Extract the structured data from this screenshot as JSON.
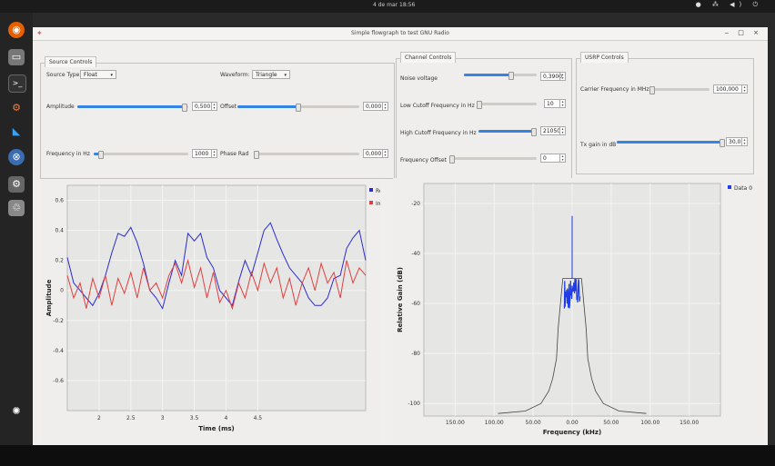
{
  "system": {
    "clock": "4 de mar  18:56",
    "tray": "● ⁂ ◀) ⏻"
  },
  "window": {
    "title": "Simple flowgraph to test GNU Radio",
    "controls": "‒ □ ×"
  },
  "source_controls": {
    "tab": "Source Controls",
    "source_type_label": "Source Type:",
    "source_type_value": "Float",
    "waveform_label": "Waveform:",
    "waveform_value": "Triangle",
    "amplitude_label": "Amplitude",
    "amplitude_value": "0,500",
    "amplitude_level": 0.97,
    "offset_label": "Offset",
    "offset_value": "0,000",
    "offset_level": 0.5,
    "frequency_label": "Frequency in Hz",
    "frequency_value": "1000",
    "frequency_level": 0.08,
    "phase_label": "Phase Rad",
    "phase_value": "0,000",
    "phase_level": 0.0
  },
  "channel_controls": {
    "tab": "Channel Controls",
    "noise_label": "Noise voltage",
    "noise_value": "0,3900",
    "noise_level": 0.65,
    "lowcut_label": "Low Cutoff Frequency in Hz",
    "lowcut_value": "10",
    "lowcut_level": 0.0,
    "highcut_label": "High Cutoff Frequency in Hz",
    "highcut_value": "21050",
    "highcut_level": 0.96,
    "freqoff_label": "Frequency Offset",
    "freqoff_value": "0",
    "freqoff_level": 0.0
  },
  "usrp_controls": {
    "tab": "USRP Controls",
    "carrier_label": "Carrier Frequency in MHz",
    "carrier_value": "100,000",
    "carrier_level": 0.02,
    "txgain_label": "Tx gain in dB",
    "txgain_value": "30,0",
    "txgain_level": 0.98
  },
  "colors": {
    "accent": "#3584e4",
    "real": "#2b2bd0",
    "imag": "#e04040",
    "spectrum": "#1e3ce8"
  },
  "chart_data": [
    {
      "type": "line",
      "xlabel": "Time (ms)",
      "ylabel": "Amplitude",
      "xlim": [
        1.5,
        6.2
      ],
      "ylim": [
        -0.8,
        0.7
      ],
      "xticks": [
        "2",
        "2.5",
        "3",
        "3.5",
        "4",
        "4.5"
      ],
      "xtick_values": [
        2,
        2.5,
        3,
        3.5,
        4,
        4.5
      ],
      "yticks": [
        "0.6",
        "0.4",
        "0.2",
        "0",
        "-0.2",
        "-0.4",
        "-0.6"
      ],
      "ytick_values": [
        0.6,
        0.4,
        0.2,
        0,
        -0.2,
        -0.4,
        -0.6
      ],
      "legend": "top-right",
      "series": [
        {
          "name": "Real",
          "x": [
            1.5,
            1.6,
            1.7,
            1.8,
            1.9,
            2.0,
            2.1,
            2.2,
            2.3,
            2.4,
            2.5,
            2.6,
            2.7,
            2.8,
            2.9,
            3.0,
            3.1,
            3.2,
            3.3,
            3.4,
            3.5,
            3.6,
            3.7,
            3.8,
            3.9,
            4.0,
            4.1,
            4.2,
            4.3,
            4.4,
            4.5,
            4.6,
            4.7,
            4.8,
            4.9,
            5.0,
            5.1,
            5.2,
            5.3,
            5.4,
            5.5,
            5.6,
            5.7,
            5.8,
            5.9,
            6.0,
            6.1,
            6.2
          ],
          "values": [
            0.22,
            0.05,
            0.0,
            -0.05,
            -0.1,
            -0.02,
            0.1,
            0.25,
            0.38,
            0.36,
            0.42,
            0.32,
            0.18,
            0.0,
            -0.05,
            -0.12,
            0.05,
            0.2,
            0.1,
            0.38,
            0.33,
            0.38,
            0.22,
            0.15,
            0.0,
            -0.05,
            -0.1,
            0.06,
            0.2,
            0.1,
            0.25,
            0.4,
            0.45,
            0.34,
            0.24,
            0.15,
            0.1,
            0.05,
            -0.05,
            -0.1,
            -0.1,
            -0.05,
            0.08,
            0.1,
            0.28,
            0.35,
            0.4,
            0.2
          ]
        },
        {
          "name": "Imag",
          "x": [
            1.5,
            1.6,
            1.7,
            1.8,
            1.9,
            2.0,
            2.1,
            2.2,
            2.3,
            2.4,
            2.5,
            2.6,
            2.7,
            2.8,
            2.9,
            3.0,
            3.1,
            3.2,
            3.3,
            3.4,
            3.5,
            3.6,
            3.7,
            3.8,
            3.9,
            4.0,
            4.1,
            4.2,
            4.3,
            4.4,
            4.5,
            4.6,
            4.7,
            4.8,
            4.9,
            5.0,
            5.1,
            5.2,
            5.3,
            5.4,
            5.5,
            5.6,
            5.7,
            5.8,
            5.9,
            6.0,
            6.1,
            6.2
          ],
          "values": [
            0.1,
            -0.05,
            0.05,
            -0.12,
            0.08,
            -0.05,
            0.1,
            -0.1,
            0.08,
            -0.02,
            0.12,
            -0.05,
            0.15,
            0.0,
            0.05,
            -0.05,
            0.1,
            0.18,
            0.05,
            0.2,
            0.02,
            0.15,
            -0.05,
            0.12,
            -0.08,
            0.0,
            -0.12,
            0.05,
            -0.05,
            0.12,
            0.0,
            0.18,
            0.05,
            0.15,
            -0.05,
            0.08,
            -0.1,
            0.05,
            0.15,
            0.0,
            0.18,
            0.05,
            0.12,
            -0.05,
            0.2,
            0.05,
            0.15,
            0.1
          ]
        }
      ]
    },
    {
      "type": "line",
      "xlabel": "Frequency (kHz)",
      "ylabel": "Relative Gain (dB)",
      "xlim": [
        -190,
        190
      ],
      "ylim": [
        -105,
        -12
      ],
      "xticks": [
        "150.00",
        "100.00",
        "50.00",
        "0.00",
        "50.00",
        "100.00",
        "150.00"
      ],
      "xtick_values": [
        -150,
        -100,
        -50,
        0,
        50,
        100,
        150
      ],
      "yticks": [
        "-20",
        "-40",
        "-60",
        "-80",
        "-100"
      ],
      "ytick_values": [
        -20,
        -40,
        -60,
        -80,
        -100
      ],
      "legend": "top-right",
      "series": [
        {
          "name": "Data 0",
          "band": {
            "x_from": -10,
            "x_to": 10,
            "low": -62,
            "high": -50
          },
          "peak": {
            "x": 0,
            "value": -25
          },
          "skirt_x": [
            -95,
            -60,
            -40,
            -30,
            -25,
            -20,
            -18,
            -12,
            12,
            18,
            20,
            25,
            30,
            40,
            60,
            95
          ],
          "skirt_values": [
            -104,
            -103,
            -100,
            -95,
            -90,
            -82,
            -70,
            -50,
            -50,
            -70,
            -82,
            -90,
            -95,
            -100,
            -103,
            -104
          ]
        }
      ]
    }
  ]
}
